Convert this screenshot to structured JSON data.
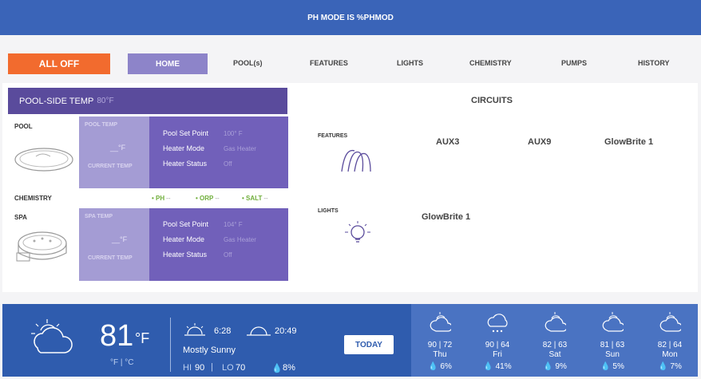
{
  "header": {
    "title": "PH MODE IS %PHMOD"
  },
  "nav": {
    "all_off": "ALL OFF",
    "home": "HOME",
    "pools": "POOL(s)",
    "features": "FEATURES",
    "lights": "LIGHTS",
    "chemistry": "CHEMISTRY",
    "pumps": "PUMPS",
    "history": "HISTORY"
  },
  "poolside": {
    "label": "POOL-SIDE TEMP",
    "value": "80°F"
  },
  "pool": {
    "label": "POOL",
    "temp_label": "POOL TEMP",
    "temp_value": "__°F",
    "current_label": "CURRENT TEMP",
    "set_point_label": "Pool Set Point",
    "set_point_value": "100° F",
    "heater_mode_label": "Heater Mode",
    "heater_mode_value": "Gas Heater",
    "heater_status_label": "Heater Status",
    "heater_status_value": "Off"
  },
  "chemistry": {
    "label": "CHEMISTRY",
    "ph": "PH",
    "ph_val": "--",
    "orp": "ORP",
    "orp_val": "--",
    "salt": "SALT",
    "salt_val": "--"
  },
  "spa": {
    "label": "SPA",
    "temp_label": "SPA TEMP",
    "temp_value": "__°F",
    "current_label": "CURRENT TEMP",
    "set_point_label": "Pool Set Point",
    "set_point_value": "104° F",
    "heater_mode_label": "Heater Mode",
    "heater_mode_value": "Gas Heater",
    "heater_status_label": "Heater Status",
    "heater_status_value": "Off"
  },
  "circuits": {
    "title": "CIRCUITS",
    "features_label": "FEATURES",
    "features": [
      "AUX3",
      "AUX9",
      "GlowBrite 1"
    ],
    "lights_label": "LIGHTS",
    "lights": [
      "GlowBrite 1"
    ]
  },
  "weather": {
    "temp": "81",
    "unit": "°F",
    "unit_toggle": "°F  |  °C",
    "sunrise": "6:28",
    "sunset": "20:49",
    "condition": "Mostly Sunny",
    "hi_label": "HI",
    "hi": "90",
    "lo_label": "LO",
    "lo": "70",
    "precip": "8%",
    "today_btn": "TODAY",
    "forecast": [
      {
        "temps": "90 | 72",
        "day": "Thu",
        "precip": "6%",
        "icon": "partly-cloudy-icon"
      },
      {
        "temps": "90 | 64",
        "day": "Fri",
        "precip": "41%",
        "icon": "rain-icon"
      },
      {
        "temps": "82 | 63",
        "day": "Sat",
        "precip": "9%",
        "icon": "partly-cloudy-icon"
      },
      {
        "temps": "81 | 63",
        "day": "Sun",
        "precip": "5%",
        "icon": "partly-cloudy-icon"
      },
      {
        "temps": "82 | 64",
        "day": "Mon",
        "precip": "7%",
        "icon": "partly-cloudy-icon"
      }
    ]
  },
  "colors": {
    "header": "#3a64b8",
    "all_off": "#f26b2e",
    "home_active": "#8d84c9",
    "panel_dark": "#5a4b9c",
    "weather": "#2f5cae"
  }
}
